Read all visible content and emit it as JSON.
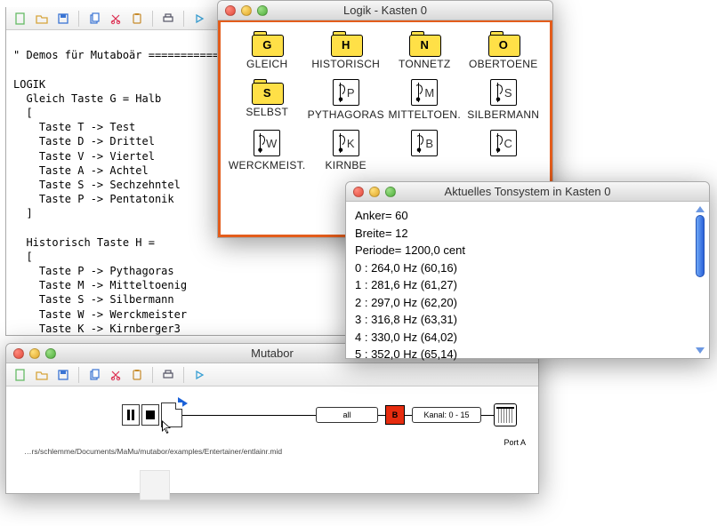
{
  "editor": {
    "header_line": "\" Demos für Mutaboär ===========",
    "label_logik": "LOGIK",
    "gleich_line": "  Gleich Taste G = Halb",
    "bracket_open": "  [",
    "gleich_maps": [
      "    Taste T -> Test",
      "    Taste D -> Drittel",
      "    Taste V -> Viertel",
      "    Taste A -> Achtel",
      "    Taste S -> Sechzehntel",
      "    Taste P -> Pentatonik"
    ],
    "bracket_close": "  ]",
    "historisch_line": "  Historisch Taste H =",
    "bracket_open2": "  [",
    "hist_maps": [
      "    Taste P -> Pythagoras",
      "    Taste M -> Mitteltoenig",
      "    Taste S -> Silbermann",
      "    Taste W -> Werckmeister",
      "    Taste K -> Kirnberger3"
    ]
  },
  "logik": {
    "title": "Logik - Kasten 0",
    "items": [
      {
        "kind": "folder",
        "key": "G",
        "label": "GLEICH"
      },
      {
        "kind": "folder",
        "key": "H",
        "label": "HISTORISCH"
      },
      {
        "kind": "folder",
        "key": "N",
        "label": "TONNETZ"
      },
      {
        "kind": "folder",
        "key": "O",
        "label": "OBERTOENE"
      },
      {
        "kind": "folder",
        "key": "S",
        "label": "SELBST"
      },
      {
        "kind": "logic",
        "key": "P",
        "label": "PYTHAGORAS"
      },
      {
        "kind": "logic",
        "key": "M",
        "label": "MITTELTOEN."
      },
      {
        "kind": "logic",
        "key": "S",
        "label": "SILBERMANN"
      },
      {
        "kind": "logic",
        "key": "W",
        "label": "WERCKMEIST."
      },
      {
        "kind": "logic",
        "key": "K",
        "label": "KIRNBE"
      },
      {
        "kind": "logic",
        "key": "B",
        "label": ""
      },
      {
        "kind": "logic",
        "key": "C",
        "label": ""
      }
    ]
  },
  "ton": {
    "title": "Aktuelles Tonsystem in Kasten 0",
    "lines": [
      "Anker= 60",
      "Breite= 12",
      "Periode= 1200,0 cent",
      "  0 : 264,0 Hz (60,16)",
      "  1 : 281,6 Hz (61,27)",
      "  2 : 297,0 Hz (62,20)",
      "  3 : 316,8 Hz (63,31)",
      "  4 : 330,0 Hz (64,02)",
      "  5 : 352,0 Hz (65,14)"
    ]
  },
  "mutabor": {
    "title": "Mutabor",
    "channel_all": "all",
    "box_label": "B",
    "channel_range": "Kanal: 0 - 15",
    "port": "Port A",
    "file_path": "…rs/schlemme/Documents/MaMu/mutabor/examples/Entertainer/entlainr.mid"
  },
  "colors": {
    "logik_frame": "#e35d1c",
    "box_red": "#e62c0f",
    "folder_yellow": "#ffe047"
  }
}
